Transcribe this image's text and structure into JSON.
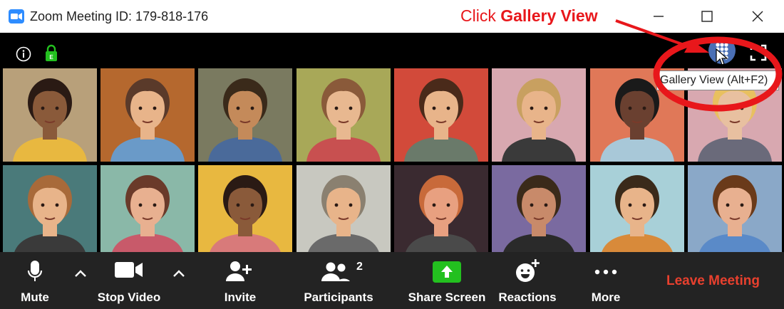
{
  "window": {
    "title": "Zoom Meeting ID: 179-818-176"
  },
  "annotation": {
    "prefix": "Click ",
    "emphasis": "Gallery View",
    "color": "#e8171b"
  },
  "top_strip": {
    "info_icon": "info-icon",
    "lock_icon": "encryption-lock-icon",
    "gallery_icon": "gallery-view-icon",
    "fullscreen_icon": "fullscreen-icon"
  },
  "tooltip": {
    "text": "Gallery View (Alt+F2)"
  },
  "participants": [
    {
      "bg": "#b8a07a",
      "skin": "#8a5a3a",
      "hair": "#2a1a14",
      "shirt": "#e8b840"
    },
    {
      "bg": "#b5682e",
      "skin": "#e8b48a",
      "hair": "#5a3a2a",
      "shirt": "#6a9ac8"
    },
    {
      "bg": "#7a7a60",
      "skin": "#c48a5a",
      "hair": "#3a2a1a",
      "shirt": "#4a6a9a"
    },
    {
      "bg": "#a8a858",
      "skin": "#e8b890",
      "hair": "#8a5a3a",
      "shirt": "#c85050"
    },
    {
      "bg": "#d24a3a",
      "skin": "#e8b48a",
      "hair": "#4a2a1a",
      "shirt": "#6a7a6a"
    },
    {
      "bg": "#d8a8b0",
      "skin": "#e8b48a",
      "hair": "#c8a060",
      "shirt": "#3a3a3a"
    },
    {
      "bg": "#e07858",
      "skin": "#6a4030",
      "hair": "#1a1a1a",
      "shirt": "#a8c8d8"
    },
    {
      "bg": "#d8a8b0",
      "skin": "#e8c0a0",
      "hair": "#e8c060",
      "shirt": "#6a6a7a"
    },
    {
      "bg": "#4a7a7a",
      "skin": "#e8b48a",
      "hair": "#a86a3a",
      "shirt": "#3a3a3a"
    },
    {
      "bg": "#8ab8a8",
      "skin": "#e8b090",
      "hair": "#6a3a2a",
      "shirt": "#c85a6a"
    },
    {
      "bg": "#e8b840",
      "skin": "#8a5a3a",
      "hair": "#2a1a14",
      "shirt": "#d87a7a"
    },
    {
      "bg": "#c8c8c0",
      "skin": "#e8b48a",
      "hair": "#8a8070",
      "shirt": "#6a6a6a"
    },
    {
      "bg": "#3a2a30",
      "skin": "#e8a080",
      "hair": "#c86a3a",
      "shirt": "#4a4a4a"
    },
    {
      "bg": "#7a6aa0",
      "skin": "#c88a6a",
      "hair": "#3a2a1a",
      "shirt": "#2a2a2a"
    },
    {
      "bg": "#a8d0d8",
      "skin": "#e8b48a",
      "hair": "#3a2a1a",
      "shirt": "#d88a3a"
    },
    {
      "bg": "#8aa8c8",
      "skin": "#e8b090",
      "hair": "#6a3a1a",
      "shirt": "#5a8ac8"
    }
  ],
  "toolbar": {
    "mute": {
      "label": "Mute",
      "icon": "microphone-icon"
    },
    "stop_video": {
      "label": "Stop Video",
      "icon": "video-camera-icon"
    },
    "invite": {
      "label": "Invite",
      "icon": "add-user-icon"
    },
    "participants": {
      "label": "Participants",
      "count": "2",
      "icon": "participants-icon"
    },
    "share_screen": {
      "label": "Share Screen",
      "icon": "share-screen-icon",
      "accent": "#23c01f"
    },
    "reactions": {
      "label": "Reactions",
      "icon": "emoji-add-icon"
    },
    "more": {
      "label": "More",
      "icon": "more-dots-icon"
    },
    "leave": {
      "label": "Leave Meeting",
      "color": "#e8402e"
    }
  }
}
